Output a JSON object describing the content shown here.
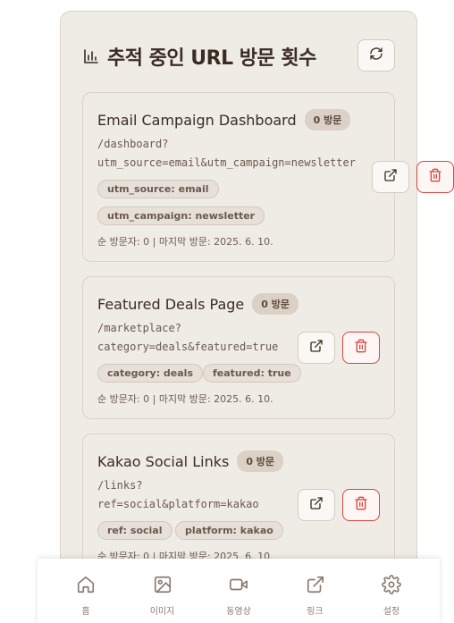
{
  "header": {
    "title": "추적 중인 URL 방문 횟수",
    "title_icon": "bar-chart-icon",
    "refresh_icon": "refresh-icon"
  },
  "cards": [
    {
      "title": "Email Campaign Dashboard",
      "visits": "0 방문",
      "url_line1": "/dashboard?",
      "url_line2": "utm_source=email&utm_campaign=newsletter",
      "tags": [
        "utm_source: email",
        "utm_campaign: newsletter"
      ],
      "stats": "순 방문자: 0 | 마지막 방문: 2025. 6. 10."
    },
    {
      "title": "Featured Deals Page",
      "visits": "0 방문",
      "url_line1": "/marketplace?",
      "url_line2": "category=deals&featured=true",
      "tags": [
        "category: deals",
        "featured: true"
      ],
      "stats": "순 방문자: 0 | 마지막 방문: 2025. 6. 10."
    },
    {
      "title": "Kakao Social Links",
      "visits": "0 방문",
      "url_line1": "/links?",
      "url_line2": "ref=social&platform=kakao",
      "tags": [
        "ref: social",
        "platform: kakao"
      ],
      "stats": "순 방문자: 0 | 마지막 방문: 2025. 6. 10."
    }
  ],
  "nav": [
    {
      "label": "홈",
      "icon": "home-icon"
    },
    {
      "label": "이미지",
      "icon": "image-icon"
    },
    {
      "label": "동영상",
      "icon": "video-icon"
    },
    {
      "label": "링크",
      "icon": "external-link-icon"
    },
    {
      "label": "설정",
      "icon": "gear-icon"
    }
  ],
  "colors": {
    "panel_bg": "#efebe5",
    "text": "#3a2c24",
    "danger": "#d8463f",
    "nav_icon": "#8a7a70"
  }
}
